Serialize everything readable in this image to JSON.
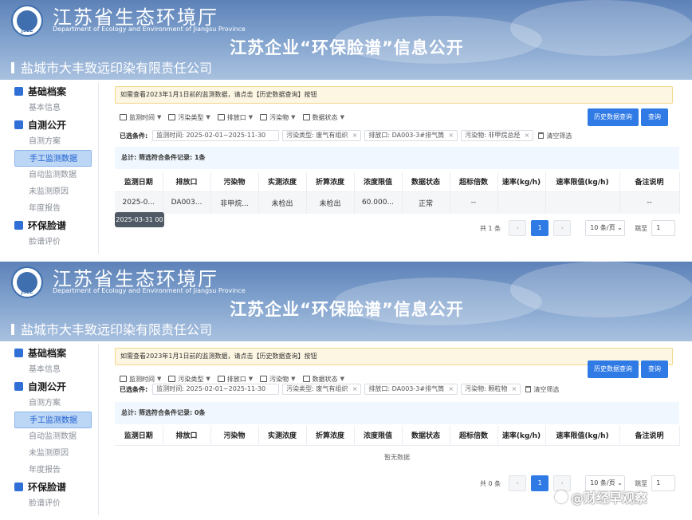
{
  "header": {
    "dept_cn": "江苏省生态环境厅",
    "dept_en": "Department of Ecology and Environment of Jiangsu Province",
    "logo_text": "JSEE",
    "portal_title": "江苏企业“环保脸谱”信息公开",
    "company": "盐城市大丰致远印染有限责任公司"
  },
  "sidebar": {
    "group1": "基础档案",
    "item_basic": "基本信息",
    "group2": "自测公开",
    "item_plan": "自测方案",
    "item_manual": "手工监测数据",
    "item_auto": "自动监测数据",
    "item_unmon": "未监测原因",
    "item_report": "年度报告",
    "group3": "环保脸谱",
    "item_eval": "脸谱评价"
  },
  "notice": "如需查看2023年1月1日前的监测数据，请点击【历史数据查询】按钮",
  "filters": {
    "time": "监测时间",
    "type": "污染类型",
    "outlet": "排放口",
    "pollutant": "污染物",
    "status": "数据状态",
    "history_btn": "历史数据查询",
    "query_btn": "查询"
  },
  "conditions": {
    "label": "已选条件:",
    "time_tag": "监测时间: 2025-02-01~2025-11-30",
    "type_tag": "污染类型: 废气有组织",
    "outlet_tag": "排放口: DA003-3#排气筒",
    "clear": "清空筛选"
  },
  "table": {
    "headers": [
      "监测日期",
      "排放口",
      "污染物",
      "实测浓度",
      "折算浓度",
      "浓度限值",
      "数据状态",
      "超标倍数",
      "速率(kg/h)",
      "速率限值(kg/h)",
      "备注说明"
    ]
  },
  "panel1": {
    "pollutant_tag": "污染物: 非甲烷总烃",
    "summary": "总计: 筛选符合条件记录: 1条",
    "row": [
      "2025-0...",
      "DA003...",
      "非甲烷...",
      "未检出",
      "未检出",
      "60.000...",
      "正常",
      "--",
      "",
      "",
      "--"
    ],
    "tooltip": "2025-03-31 00",
    "total": "共 1 条",
    "page": "1",
    "page_size": "10 条/页",
    "goto": "跳至",
    "goto_value": "1"
  },
  "panel2": {
    "pollutant_tag": "污染物: 颗粒物",
    "summary": "总计: 筛选符合条件记录: 0条",
    "empty": "暂无数据",
    "total": "共 0 条",
    "page": "1",
    "page_size": "10 条/页",
    "goto": "跳至",
    "goto_value": "1"
  },
  "watermark": "@财经早观察",
  "colors": {
    "accent": "#2f7ae5",
    "banner": "#5d82b8",
    "notice_bg": "#fdf6e3",
    "active_item": "#bcd6f5"
  }
}
